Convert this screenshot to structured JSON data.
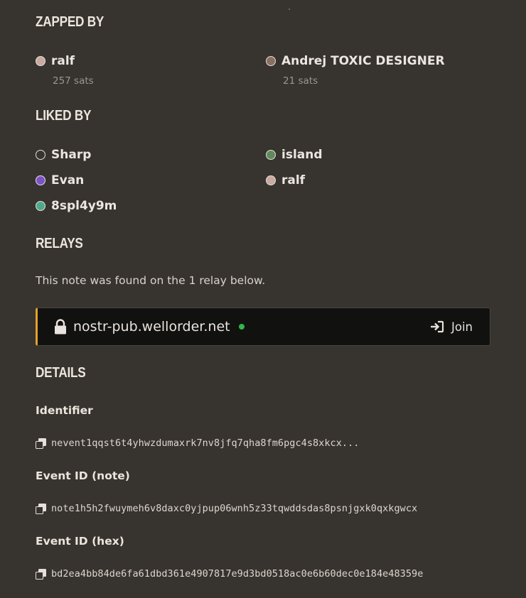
{
  "zapped_by": {
    "heading": "ZAPPED BY",
    "items": [
      {
        "name": "ralf",
        "amount": "257 sats",
        "avatar_color": "#c9a9a0"
      },
      {
        "name": "Andrej TOXIC DESIGNER",
        "amount": "21 sats",
        "avatar_color": "#8a6f63"
      }
    ]
  },
  "liked_by": {
    "heading": "LIKED BY",
    "items": [
      {
        "name": "Sharp",
        "avatar_color": "#37332f"
      },
      {
        "name": "island",
        "avatar_color": "#5f8a5c"
      },
      {
        "name": "Evan",
        "avatar_color": "#7c52c9"
      },
      {
        "name": "ralf",
        "avatar_color": "#c9a9a0"
      },
      {
        "name": "8spl4y9m",
        "avatar_color": "#4fa88a"
      }
    ]
  },
  "relays": {
    "heading": "RELAYS",
    "description": "This note was found on the 1 relay below.",
    "items": [
      {
        "name": "nostr-pub.wellorder.net",
        "status_color": "#2fb84a",
        "action_label": "Join"
      }
    ]
  },
  "details": {
    "heading": "DETAILS",
    "fields": [
      {
        "label": "Identifier",
        "value": "nevent1qqst6t4yhwzdumaxrk7nv8jfq7qha8fm6pgc4s8xkcx..."
      },
      {
        "label": "Event ID (note)",
        "value": "note1h5h2fwuymeh6v8daxc0yjpup06wnh5z33tqwddsdas8psnjgxk0qxkgwcx"
      },
      {
        "label": "Event ID (hex)",
        "value": "bd2ea4bb84de6fa61dbd361e4907817e9d3bd0518ac0e6b60dec0e184e48359e"
      }
    ]
  },
  "colors": {
    "background": "#37332f",
    "relay_card": "#111110",
    "accent": "#e0a128"
  }
}
